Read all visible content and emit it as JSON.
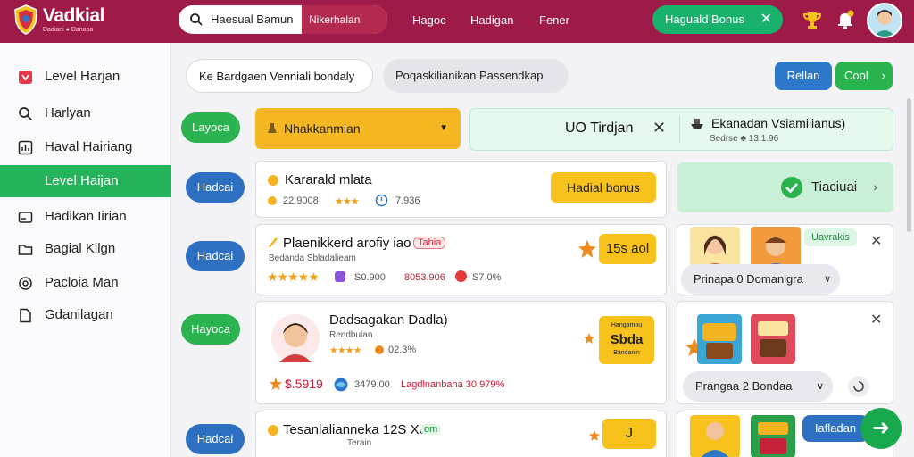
{
  "brand": {
    "name": "Vadkial",
    "tagline": "Dadiani ● Danapa"
  },
  "search": {
    "value": "Haesual Bamun",
    "button": "Nikerhalan"
  },
  "nav": [
    "Hagoc",
    "Hadigan",
    "Fener"
  ],
  "bonus_pill": {
    "label": "Haguald Bonus",
    "close": "✕"
  },
  "sidebar": {
    "items": [
      {
        "label": "Level Harjan",
        "icon": "shield-icon"
      },
      {
        "label": "Harlyan",
        "icon": "search-icon"
      },
      {
        "label": "Haval Hairiang",
        "icon": "chart-icon"
      },
      {
        "label": "Level Haijan",
        "icon": "",
        "active": true
      },
      {
        "label": "Hadikan Iirian",
        "icon": "card-icon"
      },
      {
        "label": "Bagial Kilgn",
        "icon": "folder-icon"
      },
      {
        "label": "Pacloia Man",
        "icon": "target-icon"
      },
      {
        "label": "Gdanilagan",
        "icon": "document-icon"
      }
    ]
  },
  "filters": {
    "chip_a": "Ke Bardgaen Venniali bondaly",
    "chip_b": "Poqaskilianikan Passendkap",
    "btn_blue": "Rellan",
    "btn_green": "Cool",
    "btn_green_chevron": "›"
  },
  "left_buttons": [
    "Layoca",
    "Hadcai",
    "Hadcai",
    "Hayoca",
    "Hadcai"
  ],
  "select": {
    "value": "Nhakkanmian",
    "arrow": "▼"
  },
  "mint_panel": {
    "title": "UO Tirdjan",
    "close": "✕",
    "right_title": "Ekanadan Vsiamilianus)",
    "right_sub": "Sedrse ♣ 13.1.96"
  },
  "rows": [
    {
      "title": "Kararald mlata",
      "rating": "22.9008",
      "stars": "★★★",
      "extra": "7.936",
      "action": "Hadial bonus"
    },
    {
      "title": "Plaenikkerd arofiy iao",
      "badge": "Tahia",
      "sub": "Bedanda Sbladalieam",
      "stars": "★★★★★",
      "price": "S0.900",
      "value": "8053.906",
      "pct": "S7.0%",
      "action": "15s aol"
    },
    {
      "title": "Dadsagakan Dadla)",
      "sub": "Rendbulan",
      "stars": "★★★★",
      "extra": "02.3%",
      "total": "$.5919",
      "meta": "3479.00",
      "tagline": "Lagdlnanbana 30.979%",
      "action_top": "Hangamou",
      "action": "Sbda",
      "action_sub": "Bandanin"
    },
    {
      "title": "Tesanlalianneka 12S Xol",
      "badge": "om",
      "sub": "Terain",
      "action": "J"
    }
  ],
  "promo_panel": {
    "label": "Tiaciuai",
    "chevron": "›"
  },
  "right_cards": [
    {
      "tag": "Uavrakis",
      "pill": "Prinapa  0  Domanigra",
      "pill_arrow": "∨",
      "close": "✕"
    },
    {
      "pill": "Prangaa  2  Bondaa",
      "pill_arrow": "∨",
      "close": "✕"
    },
    {
      "button": "Iafladan"
    }
  ],
  "fab": "➜",
  "colors": {
    "brand": "#9e1a48",
    "accent_green": "#2bb34f",
    "accent_blue": "#2d6fc0",
    "yellow": "#f7c21c"
  }
}
